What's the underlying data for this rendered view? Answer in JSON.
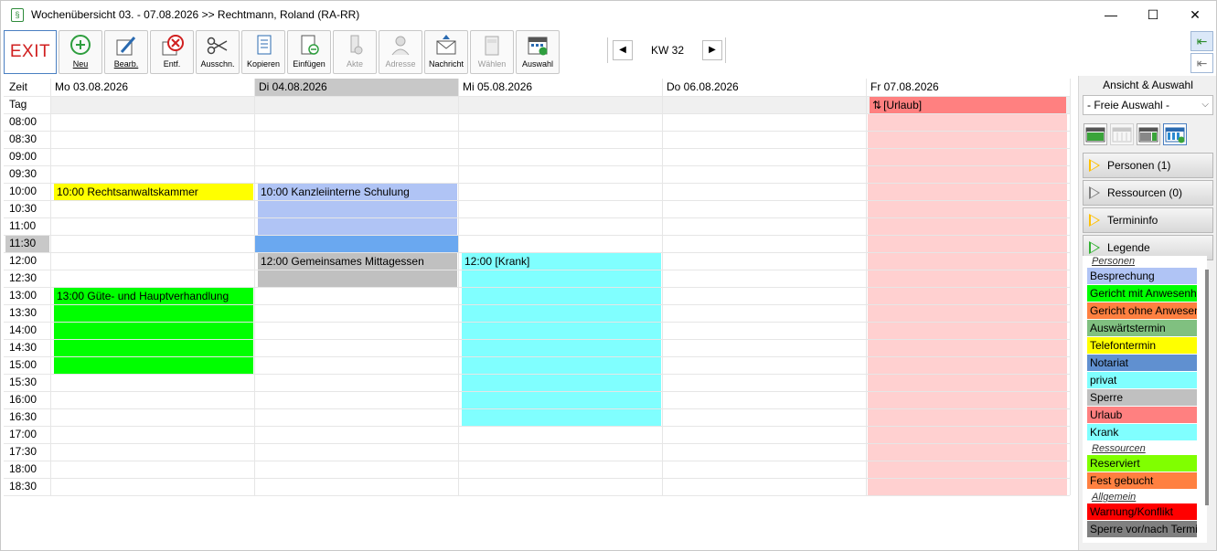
{
  "window": {
    "title": "Wochenübersicht 03. - 07.08.2026 >> Rechtmann, Roland (RA-RR)",
    "app_icon": "§",
    "minimize": "—",
    "maximize": "☐",
    "close": "✕"
  },
  "toolbar": {
    "exit": "EXIT",
    "buttons": [
      {
        "id": "neu",
        "label": "Neu",
        "icon": "plus-circle-icon",
        "enabled": true
      },
      {
        "id": "bearb",
        "label": "Bearb.",
        "icon": "pencil-icon",
        "enabled": true
      },
      {
        "id": "entf",
        "label": "Entf.",
        "icon": "delete-circle-icon",
        "enabled": true
      },
      {
        "id": "ausschn",
        "label": "Ausschn.",
        "icon": "scissors-icon",
        "enabled": true
      },
      {
        "id": "kopieren",
        "label": "Kopieren",
        "icon": "copy-icon",
        "enabled": true
      },
      {
        "id": "einfuegen",
        "label": "Einfügen",
        "icon": "paste-icon",
        "enabled": true
      },
      {
        "id": "akte",
        "label": "Akte",
        "icon": "file-icon",
        "enabled": false
      },
      {
        "id": "adresse",
        "label": "Adresse",
        "icon": "person-icon",
        "enabled": false
      },
      {
        "id": "nachricht",
        "label": "Nachricht",
        "icon": "mail-icon",
        "enabled": true
      },
      {
        "id": "waehlen",
        "label": "Wählen",
        "icon": "phone-icon",
        "enabled": false
      },
      {
        "id": "auswahl",
        "label": "Auswahl",
        "icon": "calendar-check-icon",
        "enabled": true
      }
    ],
    "week_label": "KW 32",
    "prev": "◀",
    "next": "▶"
  },
  "calendar": {
    "time_header": "Zeit",
    "allday_label": "Tag",
    "current_time_label": "11:30",
    "days": [
      {
        "label": "Mo 03.08.2026",
        "highlight": false
      },
      {
        "label": "Di 04.08.2026",
        "highlight": true
      },
      {
        "label": "Mi 05.08.2026",
        "highlight": false
      },
      {
        "label": "Do 06.08.2026",
        "highlight": false
      },
      {
        "label": "Fr 07.08.2026",
        "highlight": false
      }
    ],
    "times": [
      "08:00",
      "08:30",
      "09:00",
      "09:30",
      "10:00",
      "10:30",
      "11:00",
      "11:30",
      "12:00",
      "12:30",
      "13:00",
      "13:30",
      "14:00",
      "14:30",
      "15:00",
      "15:30",
      "16:00",
      "16:30",
      "17:00",
      "17:30",
      "18:00",
      "18:30"
    ],
    "allday_events": [
      {
        "day": 4,
        "text": "[Urlaub]",
        "color": "#ff8080",
        "icon": "arrows-vertical-icon"
      }
    ],
    "events": [
      {
        "day": 0,
        "start": 4,
        "slots": 1,
        "text": "10:00 Rechtsanwaltskammer",
        "color": "#ffff00"
      },
      {
        "day": 1,
        "start": 4,
        "slots": 3,
        "text": "10:00 Kanzleiinterne Schulung",
        "color": "#b0c4f5"
      },
      {
        "day": 1,
        "start": 8,
        "slots": 2,
        "text": "12:00 Gemeinsames Mittagessen",
        "color": "#c0c0c0"
      },
      {
        "day": 2,
        "start": 8,
        "slots": 10,
        "text": "12:00 [Krank]",
        "color": "#80ffff"
      },
      {
        "day": 0,
        "start": 10,
        "slots": 5,
        "text": "13:00 Güte- und Hauptverhandlung",
        "color": "#00ff00"
      }
    ],
    "vacation_day_color": "#ffd0d0",
    "current_slot_color": "#6aa8f0"
  },
  "sidepanel": {
    "title": "Ansicht & Auswahl",
    "select_value": "- Freie Auswahl -",
    "sections": [
      {
        "label": "Personen (1)",
        "color": "#ffc000"
      },
      {
        "label": "Ressourcen (0)",
        "color": "#808080"
      },
      {
        "label": "Termininfo",
        "color": "#ffc000"
      },
      {
        "label": "Legende",
        "color": "#30b030"
      }
    ],
    "legend_groups": [
      {
        "title": "Personen",
        "items": [
          {
            "label": "Besprechung",
            "color": "#b0c4f5"
          },
          {
            "label": "Gericht mit Anwesenheit",
            "color": "#00ff00"
          },
          {
            "label": "Gericht ohne Anwesenheit",
            "color": "#ff8040"
          },
          {
            "label": "Auswärtstermin",
            "color": "#80c080"
          },
          {
            "label": "Telefontermin",
            "color": "#ffff00"
          },
          {
            "label": "Notariat",
            "color": "#6090d0"
          },
          {
            "label": "privat",
            "color": "#80ffff"
          },
          {
            "label": "Sperre",
            "color": "#c0c0c0"
          },
          {
            "label": "Urlaub",
            "color": "#ff8080"
          },
          {
            "label": "Krank",
            "color": "#80ffff"
          }
        ]
      },
      {
        "title": "Ressourcen",
        "items": [
          {
            "label": "Reserviert",
            "color": "#80ff00"
          },
          {
            "label": "Fest gebucht",
            "color": "#ff8040"
          }
        ]
      },
      {
        "title": "Allgemein",
        "items": [
          {
            "label": "Warnung/Konflikt",
            "color": "#ff0000"
          },
          {
            "label": "Sperre vor/nach Termin",
            "color": "#808080"
          }
        ]
      }
    ]
  }
}
